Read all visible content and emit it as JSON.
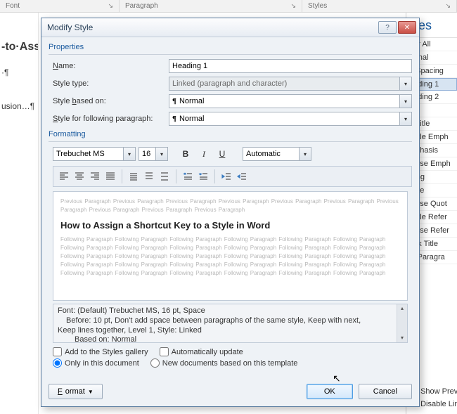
{
  "ribbon": {
    "font": "Font",
    "paragraph": "Paragraph",
    "styles": "Styles"
  },
  "doc": {
    "title_fragment": "-to·Ass",
    "para_mark1": "·¶",
    "line2": "usion…¶"
  },
  "styles_pane": {
    "heading": "yles",
    "items": [
      "ear All",
      "ormal",
      "o Spacing",
      "eading 1",
      "eading 2",
      "tle",
      "ubtitle",
      "ubtle Emph",
      "mphasis",
      "tense Emph",
      "rong",
      "uote",
      "tense Quot",
      "ubtle Refer",
      "tense Refer",
      "ook Title",
      "st Paragra"
    ],
    "footer1": "Show Previ",
    "footer2": "Disable Lin"
  },
  "dialog": {
    "title": "Modify Style",
    "sections": {
      "properties": "Properties",
      "formatting": "Formatting"
    },
    "labels": {
      "name": "Name:",
      "style_type": "Style type:",
      "style_based_on": "Style based on:",
      "following": "Style for following paragraph:"
    },
    "values": {
      "name": "Heading 1",
      "style_type": "Linked (paragraph and character)",
      "based_on": "Normal",
      "following": "Normal",
      "font": "Trebuchet MS",
      "size": "16",
      "color_label": "Automatic"
    },
    "toolbar": {
      "bold": "B",
      "italic": "I",
      "underline": "U"
    },
    "preview": {
      "prev_text": "Previous Paragraph Previous Paragraph Previous Paragraph Previous Paragraph Previous Paragraph Previous Paragraph Previous Paragraph Previous Paragraph Previous Paragraph Previous Paragraph",
      "sample": "How to Assign a Shortcut Key to a Style in Word",
      "follow_text": "Following Paragraph Following Paragraph Following Paragraph Following Paragraph Following Paragraph Following Paragraph Following Paragraph Following Paragraph Following Paragraph Following Paragraph Following Paragraph Following Paragraph Following Paragraph Following Paragraph Following Paragraph Following Paragraph Following Paragraph Following Paragraph Following Paragraph Following Paragraph Following Paragraph Following Paragraph Following Paragraph Following Paragraph Following Paragraph Following Paragraph Following Paragraph Following Paragraph Following Paragraph Following Paragraph"
    },
    "description": {
      "l1": "Font: (Default) Trebuchet MS, 16 pt, Space",
      "l2": "Before:  10 pt, Don't add space between paragraphs of the same style, Keep with next,",
      "l3": "Keep lines together, Level 1, Style: Linked",
      "l4": "Based on: Normal"
    },
    "checks": {
      "add_gallery": "Add to the Styles gallery",
      "auto_update": "Automatically update",
      "only_doc": "Only in this document",
      "new_docs": "New documents based on this template"
    },
    "buttons": {
      "format": "Format",
      "ok": "OK",
      "cancel": "Cancel"
    }
  }
}
